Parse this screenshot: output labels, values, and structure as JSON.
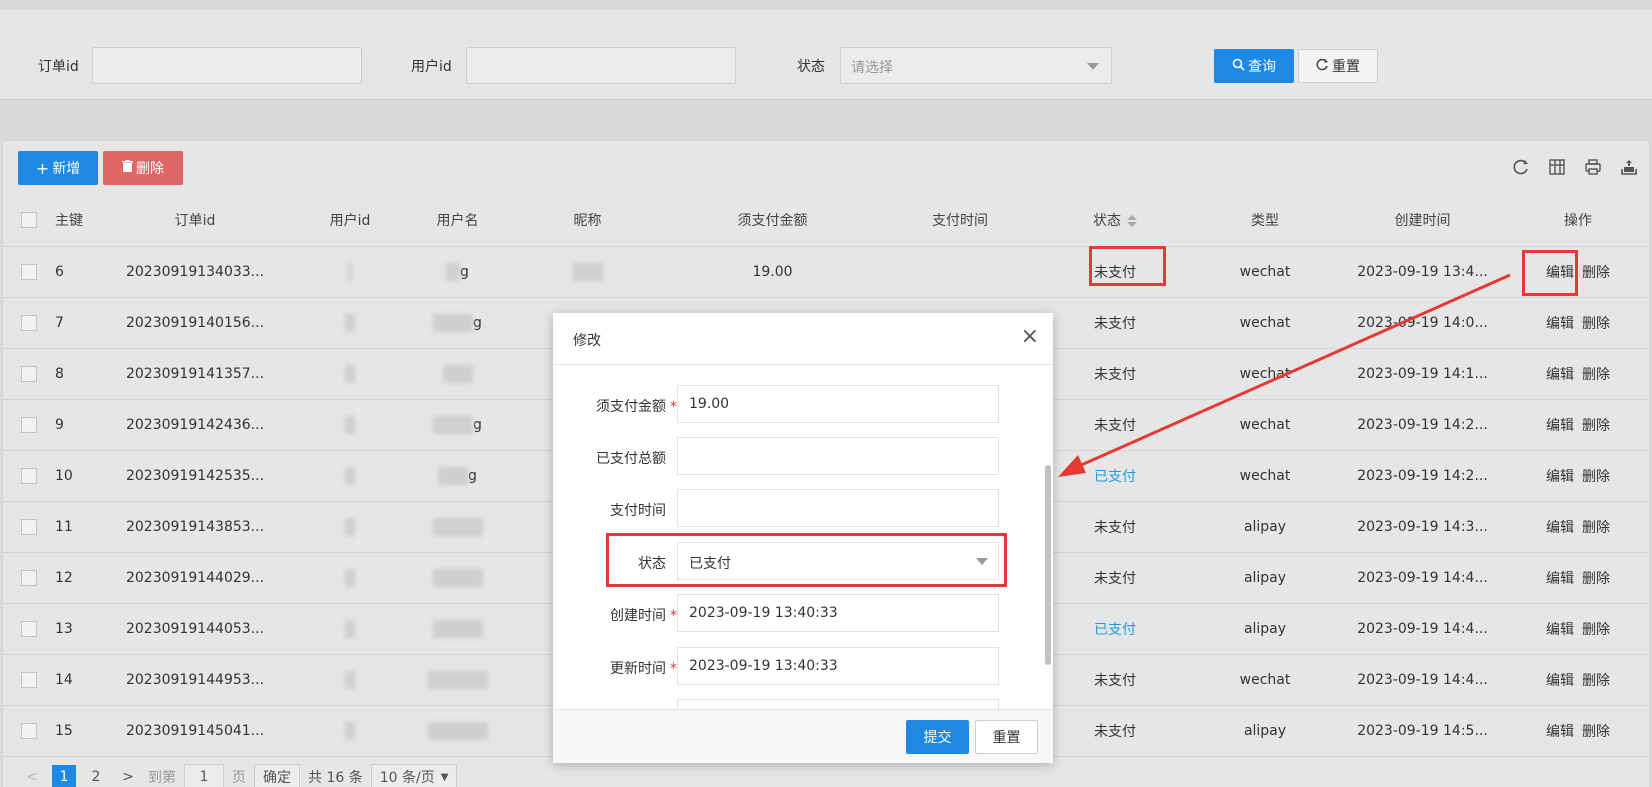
{
  "search": {
    "order_id_label": "订单id",
    "user_id_label": "用户id",
    "status_label": "状态",
    "status_placeholder": "请选择",
    "query_button": "查询",
    "reset_button": "重置"
  },
  "toolbar": {
    "add_button": "新增",
    "delete_button": "删除"
  },
  "table": {
    "headers": [
      "主键",
      "订单id",
      "用户id",
      "用户名",
      "昵称",
      "须支付金额",
      "支付时间",
      "状态",
      "类型",
      "创建时间",
      "操作"
    ],
    "edit_label": "编辑",
    "delete_label": "删除",
    "rows": [
      {
        "id": "6",
        "order_id": "20230919134033...",
        "user_name": "g",
        "amount": "19.00",
        "status": "未支付",
        "type": "wechat",
        "created": "2023-09-19 13:4..."
      },
      {
        "id": "7",
        "order_id": "20230919140156...",
        "user_name": "g",
        "amount": "",
        "status": "未支付",
        "type": "wechat",
        "created": "2023-09-19 14:0..."
      },
      {
        "id": "8",
        "order_id": "20230919141357...",
        "user_name": "",
        "amount": "",
        "status": "未支付",
        "type": "wechat",
        "created": "2023-09-19 14:1..."
      },
      {
        "id": "9",
        "order_id": "20230919142436...",
        "user_name": "g",
        "amount": "",
        "status": "未支付",
        "type": "wechat",
        "created": "2023-09-19 14:2..."
      },
      {
        "id": "10",
        "order_id": "20230919142535...",
        "user_name": "g",
        "amount": "",
        "status": "已支付",
        "type": "wechat",
        "created": "2023-09-19 14:2..."
      },
      {
        "id": "11",
        "order_id": "20230919143853...",
        "user_name": "",
        "amount": "",
        "status": "未支付",
        "type": "alipay",
        "created": "2023-09-19 14:3..."
      },
      {
        "id": "12",
        "order_id": "20230919144029...",
        "user_name": "",
        "amount": "",
        "status": "未支付",
        "type": "alipay",
        "created": "2023-09-19 14:4..."
      },
      {
        "id": "13",
        "order_id": "20230919144053...",
        "user_name": "",
        "amount": "",
        "status": "已支付",
        "type": "alipay",
        "created": "2023-09-19 14:4..."
      },
      {
        "id": "14",
        "order_id": "20230919144953...",
        "user_name": "",
        "amount": "",
        "status": "未支付",
        "type": "wechat",
        "created": "2023-09-19 14:4..."
      },
      {
        "id": "15",
        "order_id": "20230919145041...",
        "user_name": "",
        "amount": "",
        "status": "未支付",
        "type": "alipay",
        "created": "2023-09-19 14:5..."
      }
    ]
  },
  "pager": {
    "prev": "<",
    "pages": [
      "1",
      "2"
    ],
    "next": ">",
    "goto_label": "到第",
    "goto_value": "1",
    "page_label": "页",
    "confirm": "确定",
    "total": "共 16 条",
    "page_size": "10 条/页"
  },
  "modal": {
    "title": "修改",
    "fields": [
      {
        "label": "须支付金额",
        "value": "19.00",
        "required": true
      },
      {
        "label": "已支付总额",
        "value": "",
        "required": false
      },
      {
        "label": "支付时间",
        "value": "",
        "required": false
      },
      {
        "label": "状态",
        "value": "已支付",
        "required": false
      },
      {
        "label": "创建时间",
        "value": "2023-09-19 13:40:33",
        "required": true
      },
      {
        "label": "更新时间",
        "value": "2023-09-19 13:40:33",
        "required": true
      }
    ],
    "submit_button": "提交",
    "reset_button": "重置"
  },
  "colors": {
    "primary": "#1e88e5",
    "danger": "#e06666",
    "paid": "#1f9bdc",
    "annotation": "#e53935"
  }
}
